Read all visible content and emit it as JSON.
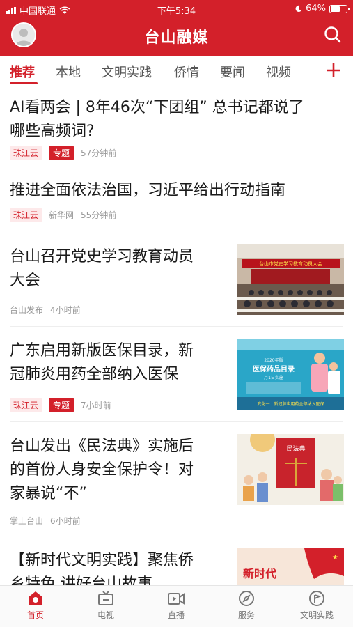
{
  "status_bar": {
    "carrier": "中国联通",
    "time": "下午5:34",
    "battery": "64%",
    "battery_level": 0.64
  },
  "header": {
    "title": "台山融媒"
  },
  "tabs": [
    {
      "label": "推荐",
      "active": true
    },
    {
      "label": "本地",
      "active": false
    },
    {
      "label": "文明实践",
      "active": false
    },
    {
      "label": "侨情",
      "active": false
    },
    {
      "label": "要闻",
      "active": false
    },
    {
      "label": "视频",
      "active": false
    }
  ],
  "feed": [
    {
      "title_lines": [
        "AI看两会 | 8年46次“下团组” 总书记都说了",
        "哪些高频词?"
      ],
      "source": "珠江云",
      "topic_tag": "专题",
      "time": "57分钟前"
    },
    {
      "title_lines": [
        "推进全面依法治国，习近平给出行动指南"
      ],
      "source": "珠江云",
      "publisher": "新华网",
      "time": "55分钟前"
    },
    {
      "title_lines": [
        "台山召开党史学习教育动员",
        "大会"
      ],
      "publisher": "台山发布",
      "time": "4小时前",
      "image_text": "台山市党史学习教育动员大会"
    },
    {
      "title_lines": [
        "广东启用新版医保目录，新",
        "冠肺炎用药全部纳入医保"
      ],
      "source": "珠江云",
      "topic_tag": "专题",
      "time": "7小时前",
      "image_text": {
        "year": "2020年版",
        "heading": "医保药品目录",
        "sub": "月1日实施",
        "banner": "变化一：新冠肺炎用药全部纳入医保"
      }
    },
    {
      "title_lines": [
        "台山发出《民法典》实施后",
        "的首份人身安全保护令！对",
        "家暴说“不”"
      ],
      "publisher": "掌上台山",
      "time": "6小时前",
      "image_text": "民法典"
    },
    {
      "title_lines": [
        "【新时代文明实践】聚焦侨",
        "乡特色 讲好台山故事"
      ],
      "image_text": "新时代"
    }
  ],
  "bottom_nav": [
    {
      "label": "首页",
      "icon": "home-icon",
      "active": true
    },
    {
      "label": "电视",
      "icon": "tv-icon",
      "active": false
    },
    {
      "label": "直播",
      "icon": "live-icon",
      "active": false
    },
    {
      "label": "服务",
      "icon": "compass-icon",
      "active": false
    },
    {
      "label": "文明实践",
      "icon": "flag-icon",
      "active": false
    }
  ],
  "colors": {
    "brand": "#d3202a",
    "tag_bg": "#fde9ea"
  }
}
